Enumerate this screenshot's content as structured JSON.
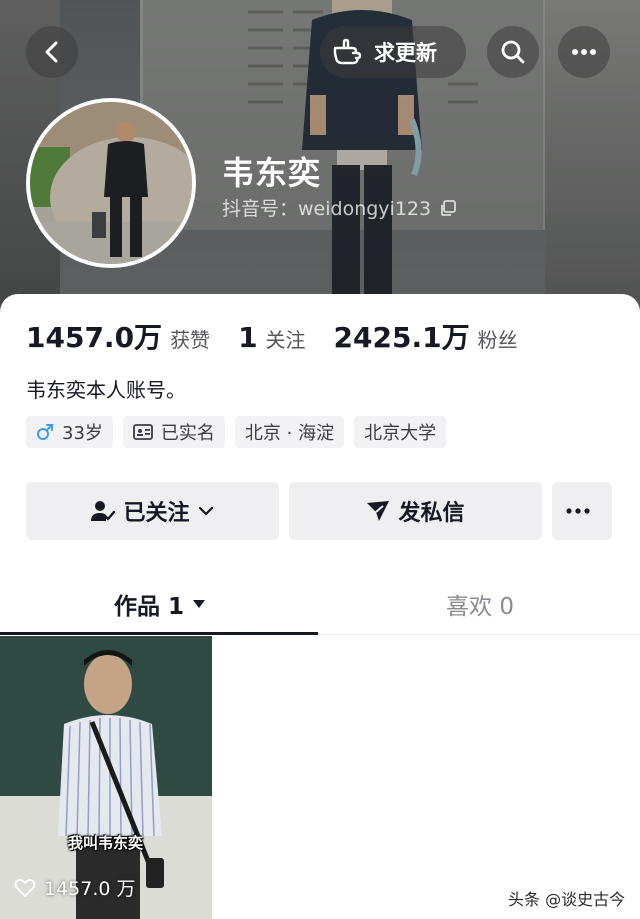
{
  "header": {
    "update_label": "求更新",
    "name": "韦东奕",
    "douyin_id": "抖音号：weidongyi123"
  },
  "stats": [
    {
      "value": "1457.0万",
      "label": "获赞"
    },
    {
      "value": "1",
      "label": "关注"
    },
    {
      "value": "2425.1万",
      "label": "粉丝"
    }
  ],
  "bio": "韦东奕本人账号。",
  "tags": {
    "age": "33岁",
    "verified": "已实名",
    "location": "北京 · 海淀",
    "school": "北京大学"
  },
  "actions": {
    "following": "已关注",
    "message": "发私信"
  },
  "tabs": {
    "works": "作品 1",
    "likes": "喜欢 0"
  },
  "video": {
    "caption": "我叫韦东奕",
    "likes": "1457.0 万"
  },
  "watermark": "头条 @谈史古今",
  "colors": {
    "text_primary": "#161823",
    "text_secondary": "#55565e",
    "male_icon": "#3d9bf0",
    "button_bg": "#efeff1"
  }
}
